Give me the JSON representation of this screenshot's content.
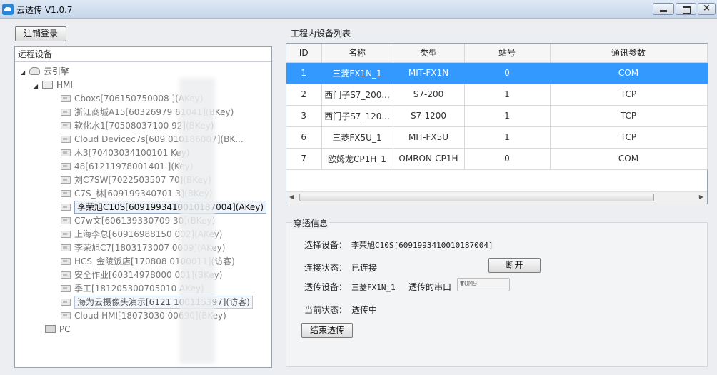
{
  "window": {
    "title": "云透传 V1.0.7"
  },
  "logout_label": "注销登录",
  "remote": {
    "header": "远程设备",
    "root_label": "云引擎",
    "hmi_label": "HMI",
    "pc_label": "PC",
    "devices": [
      "Cboxs[706150750008           ](AKey)",
      "浙江商城A15[60326979           61041](BKey)",
      "软化水1[70508037100           92](BKey)",
      "Cloud Devicec7s[609           010186007](BK...",
      "木3[70403034100101            Key)",
      "48[61211978001401           ](Key)",
      "刘C7SW[7022503507           70](BKey)",
      "C7S_林[609199340701           3](BKey)",
      "李荣旭C10S[6091993410010187004](AKey)",
      "C7w文[606139330709           30](BKey)",
      "上海李总[60916988150           002](AKey)",
      "李荣旭C7[1803173007           0009](AKey)",
      "HCS_金陵饭店[170808           0100011](访客)",
      "安全作业[60314978000           001](BKey)",
      "季工[181205300705010           AKey)",
      "海为云摄像头演示[6121          100115397](访客)",
      "Cloud HMI[18073030           00690](BKey)"
    ]
  },
  "device_list": {
    "title": "工程内设备列表",
    "columns": [
      "ID",
      "名称",
      "类型",
      "站号",
      "通讯参数"
    ],
    "rows": [
      [
        "1",
        "三菱FX1N_1",
        "MIT-FX1N",
        "0",
        "COM"
      ],
      [
        "2",
        "西门子S7_200...",
        "S7-200",
        "1",
        "TCP"
      ],
      [
        "3",
        "西门子S7_120...",
        "S7-1200",
        "1",
        "TCP"
      ],
      [
        "6",
        "三菱FX5U_1",
        "MIT-FX5U",
        "1",
        "TCP"
      ],
      [
        "7",
        "欧姆龙CP1H_1",
        "OMRON-CP1H",
        "0",
        "COM"
      ]
    ]
  },
  "tunnel": {
    "legend": "穿透信息",
    "select_device_label": "选择设备：",
    "select_device_value": "李荣旭C10S[6091993410010187004]",
    "conn_status_label": "连接状态：",
    "conn_status_value": "已连接",
    "disconnect_label": "断开",
    "tunnel_device_label": "透传设备：",
    "tunnel_device_value": "三菱FX1N_1",
    "serial_port_label": "透传的串口",
    "serial_port_value": "COM9",
    "current_status_label": "当前状态：",
    "current_status_value": "透传中",
    "end_label": "结束透传"
  }
}
